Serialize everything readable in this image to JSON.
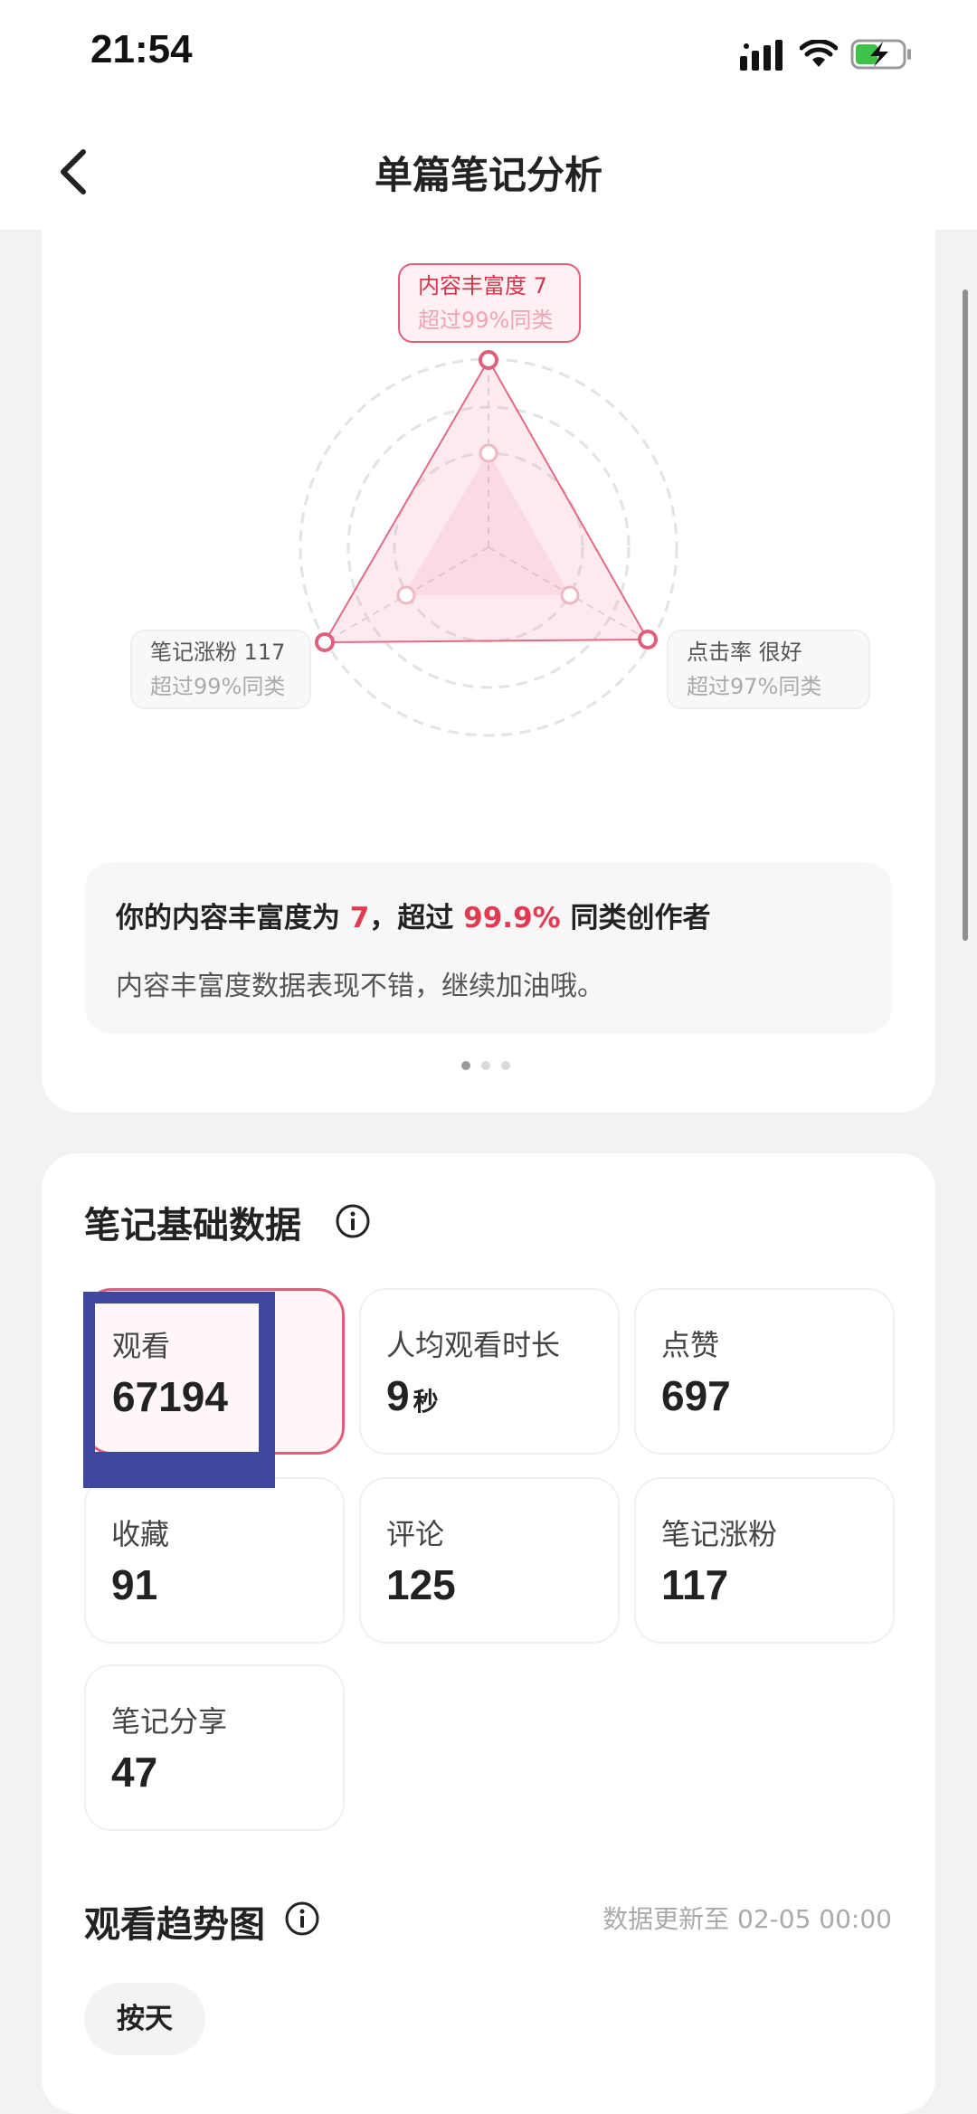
{
  "status_bar": {
    "time": "21:54"
  },
  "nav": {
    "title": "单篇笔记分析"
  },
  "radar": {
    "top": {
      "label": "内容丰富度 7",
      "sub": "超过99%同类"
    },
    "left": {
      "label": "笔记涨粉 117",
      "sub": "超过99%同类"
    },
    "right": {
      "label": "点击率 很好",
      "sub": "超过97%同类"
    }
  },
  "summary": {
    "prefix": "你的内容丰富度为 ",
    "value": "7",
    "middle": "，超过 ",
    "percent": "99.9%",
    "suffix": " 同类创作者",
    "desc": "内容丰富度数据表现不错，继续加油哦。"
  },
  "basic": {
    "title": "笔记基础数据",
    "metrics": [
      {
        "label": "观看",
        "value": "67194",
        "unit": ""
      },
      {
        "label": "人均观看时长",
        "value": "9",
        "unit": "秒"
      },
      {
        "label": "点赞",
        "value": "697",
        "unit": ""
      },
      {
        "label": "收藏",
        "value": "91",
        "unit": ""
      },
      {
        "label": "评论",
        "value": "125",
        "unit": ""
      },
      {
        "label": "笔记涨粉",
        "value": "117",
        "unit": ""
      },
      {
        "label": "笔记分享",
        "value": "47",
        "unit": ""
      }
    ]
  },
  "trend": {
    "title": "观看趋势图",
    "update": "数据更新至 02-05 00:00",
    "chip": "按天"
  },
  "colors": {
    "accent": "#e33a52",
    "annotation": "#3f48a1"
  },
  "icons": [
    "back-arrow-icon",
    "signal-icon",
    "wifi-icon",
    "battery-charging-icon",
    "info-icon"
  ]
}
